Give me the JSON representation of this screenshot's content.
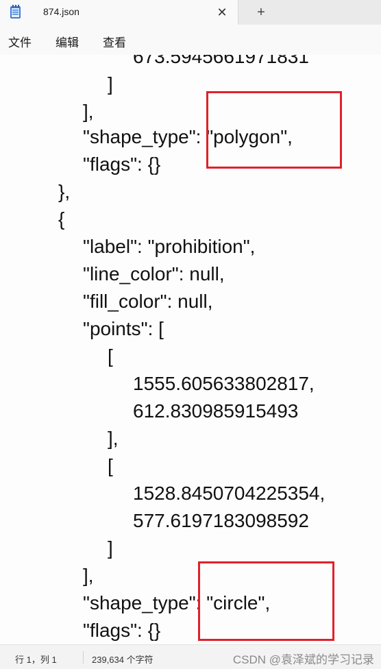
{
  "tab": {
    "title": "874.json",
    "close_glyph": "✕",
    "icon": "notepad-icon"
  },
  "new_tab_glyph": "+",
  "menu": {
    "items": [
      "文件",
      "编辑",
      "查看"
    ]
  },
  "code": {
    "lines": [
      "673.5945661971831",
      "]",
      "],",
      "\"shape_type\": \"polygon\",",
      "\"flags\": {}",
      "},",
      "{",
      "\"label\": \"prohibition\",",
      "\"line_color\": null,",
      "\"fill_color\": null,",
      "\"points\": [",
      "[",
      "1555.605633802817,",
      "612.830985915493",
      "],",
      "[",
      "1528.8450704225354,",
      "577.6197183098592",
      "]",
      "],",
      "\"shape_type\": \"circle\",",
      "\"flags\": {}"
    ]
  },
  "annotations": {
    "color": "#e0202a"
  },
  "status": {
    "position": "行 1，列 1",
    "char_count": "239,634 个字符",
    "watermark": "CSDN @袁泽斌的学习记录"
  }
}
